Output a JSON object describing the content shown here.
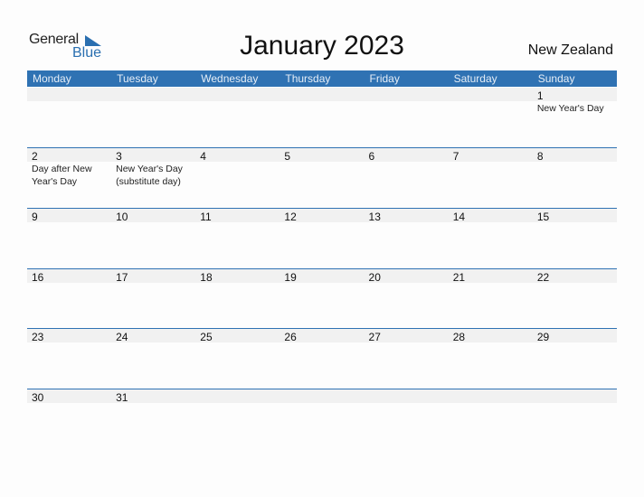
{
  "logo": {
    "general": "General",
    "blue": "Blue"
  },
  "title": "January 2023",
  "country": "New Zealand",
  "weekdays": [
    "Monday",
    "Tuesday",
    "Wednesday",
    "Thursday",
    "Friday",
    "Saturday",
    "Sunday"
  ],
  "weeks": [
    [
      {
        "day": ""
      },
      {
        "day": ""
      },
      {
        "day": ""
      },
      {
        "day": ""
      },
      {
        "day": ""
      },
      {
        "day": ""
      },
      {
        "day": "1",
        "event": "New Year's Day"
      }
    ],
    [
      {
        "day": "2",
        "event": "Day after New Year's Day"
      },
      {
        "day": "3",
        "event": "New Year's Day (substitute day)"
      },
      {
        "day": "4"
      },
      {
        "day": "5"
      },
      {
        "day": "6"
      },
      {
        "day": "7"
      },
      {
        "day": "8"
      }
    ],
    [
      {
        "day": "9"
      },
      {
        "day": "10"
      },
      {
        "day": "11"
      },
      {
        "day": "12"
      },
      {
        "day": "13"
      },
      {
        "day": "14"
      },
      {
        "day": "15"
      }
    ],
    [
      {
        "day": "16"
      },
      {
        "day": "17"
      },
      {
        "day": "18"
      },
      {
        "day": "19"
      },
      {
        "day": "20"
      },
      {
        "day": "21"
      },
      {
        "day": "22"
      }
    ],
    [
      {
        "day": "23"
      },
      {
        "day": "24"
      },
      {
        "day": "25"
      },
      {
        "day": "26"
      },
      {
        "day": "27"
      },
      {
        "day": "28"
      },
      {
        "day": "29"
      }
    ],
    [
      {
        "day": "30"
      },
      {
        "day": "31"
      },
      {
        "day": ""
      },
      {
        "day": ""
      },
      {
        "day": ""
      },
      {
        "day": ""
      },
      {
        "day": ""
      }
    ]
  ],
  "colors": {
    "accent": "#2f72b3",
    "dayrow_bg": "#f1f1f1"
  }
}
